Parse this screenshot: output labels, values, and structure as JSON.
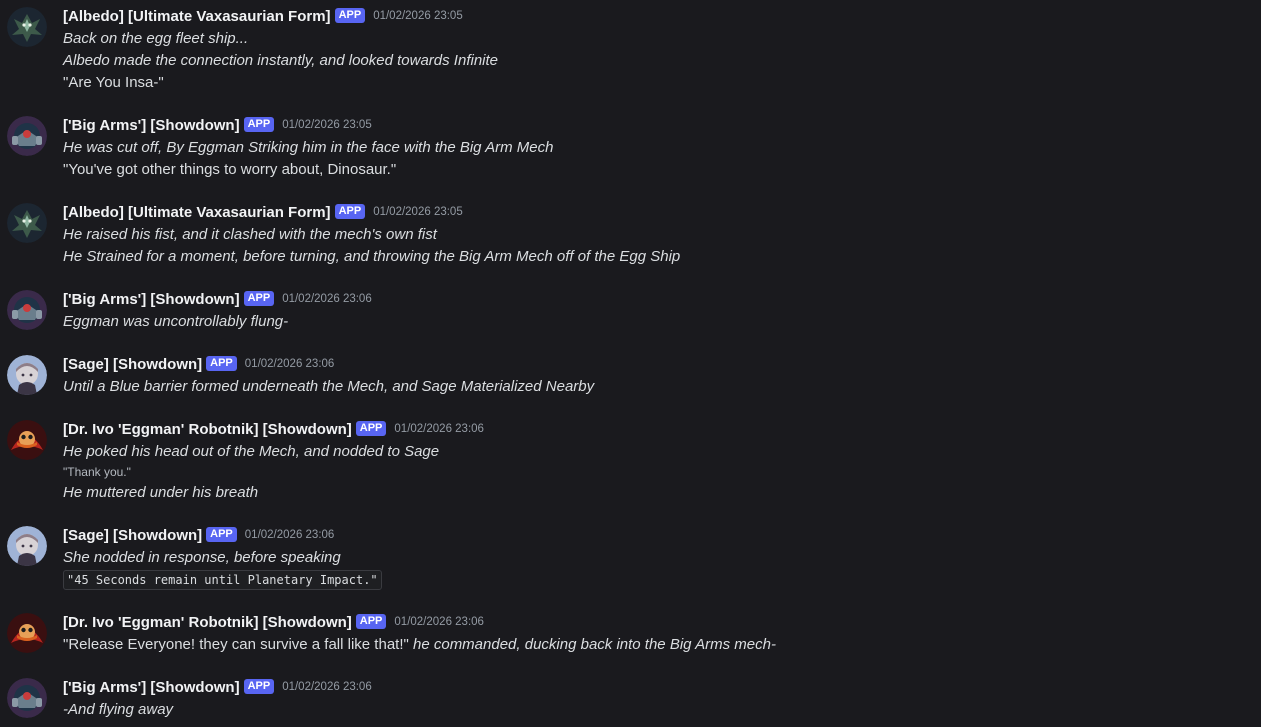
{
  "messages": [
    {
      "author": "[Albedo] [Ultimate Vaxasaurian Form]",
      "badge": "APP",
      "time": "01/02/2026 23:05",
      "avatar": "albedo-avatar",
      "lines": [
        {
          "text": "Back on the egg fleet ship...",
          "style": "italic"
        },
        {
          "text": "Albedo made the connection instantly, and looked towards Infinite",
          "style": "italic"
        },
        {
          "text": "\"Are You Insa-\"",
          "style": "normal"
        }
      ]
    },
    {
      "author": "['Big Arms'] [Showdown]",
      "badge": "APP",
      "time": "01/02/2026 23:05",
      "avatar": "big-arms-avatar",
      "lines": [
        {
          "text": "He was cut off, By Eggman Striking him in the face with the Big Arm Mech",
          "style": "italic"
        },
        {
          "text": "\"You've got other things to worry about, Dinosaur.\"",
          "style": "normal"
        }
      ]
    },
    {
      "author": "[Albedo] [Ultimate Vaxasaurian Form]",
      "badge": "APP",
      "time": "01/02/2026 23:05",
      "avatar": "albedo-avatar",
      "lines": [
        {
          "text": "He raised his fist, and it clashed with the mech's own fist",
          "style": "italic"
        },
        {
          "text": "He Strained for a moment, before turning, and throwing the Big Arm Mech off of the Egg Ship",
          "style": "italic"
        }
      ]
    },
    {
      "author": "['Big Arms'] [Showdown]",
      "badge": "APP",
      "time": "01/02/2026 23:06",
      "avatar": "big-arms-avatar",
      "lines": [
        {
          "text": "Eggman was uncontrollably flung-",
          "style": "italic"
        }
      ]
    },
    {
      "author": "[Sage] [Showdown]",
      "badge": "APP",
      "time": "01/02/2026 23:06",
      "avatar": "sage-avatar",
      "lines": [
        {
          "text": "Until a Blue barrier formed underneath the Mech, and Sage Materialized Nearby",
          "style": "italic"
        }
      ]
    },
    {
      "author": "[Dr. Ivo 'Eggman' Robotnik] [Showdown]",
      "badge": "APP",
      "time": "01/02/2026 23:06",
      "avatar": "eggman-avatar",
      "lines": [
        {
          "text": "He poked his head out of the Mech, and nodded to Sage",
          "style": "italic"
        },
        {
          "text": "\"Thank you.\"",
          "style": "small"
        },
        {
          "text": "He muttered under his breath",
          "style": "italic"
        }
      ]
    },
    {
      "author": "[Sage] [Showdown]",
      "badge": "APP",
      "time": "01/02/2026 23:06",
      "avatar": "sage-avatar",
      "lines": [
        {
          "text": "She nodded in response, before speaking",
          "style": "italic"
        },
        {
          "text": "\"45 Seconds remain until Planetary Impact.\"",
          "style": "code"
        }
      ]
    },
    {
      "author": "[Dr. Ivo 'Eggman' Robotnik] [Showdown]",
      "badge": "APP",
      "time": "01/02/2026 23:06",
      "avatar": "eggman-avatar",
      "lines": [
        {
          "text": "\"Release Everyone! they can survive a fall like that!\"",
          "style": "normal",
          "append": {
            "text": " he commanded, ducking back into the Big Arms mech-",
            "style": "italic"
          }
        }
      ]
    },
    {
      "author": "['Big Arms'] [Showdown]",
      "badge": "APP",
      "time": "01/02/2026 23:06",
      "avatar": "big-arms-avatar",
      "lines": [
        {
          "text": "-And flying away",
          "style": "italic"
        }
      ]
    }
  ],
  "colors": {
    "background": "#1a1a1e",
    "author": "#f2f3f5",
    "text": "#dbdee1",
    "timestamp": "#949ba4",
    "badge": "#5865f2"
  }
}
